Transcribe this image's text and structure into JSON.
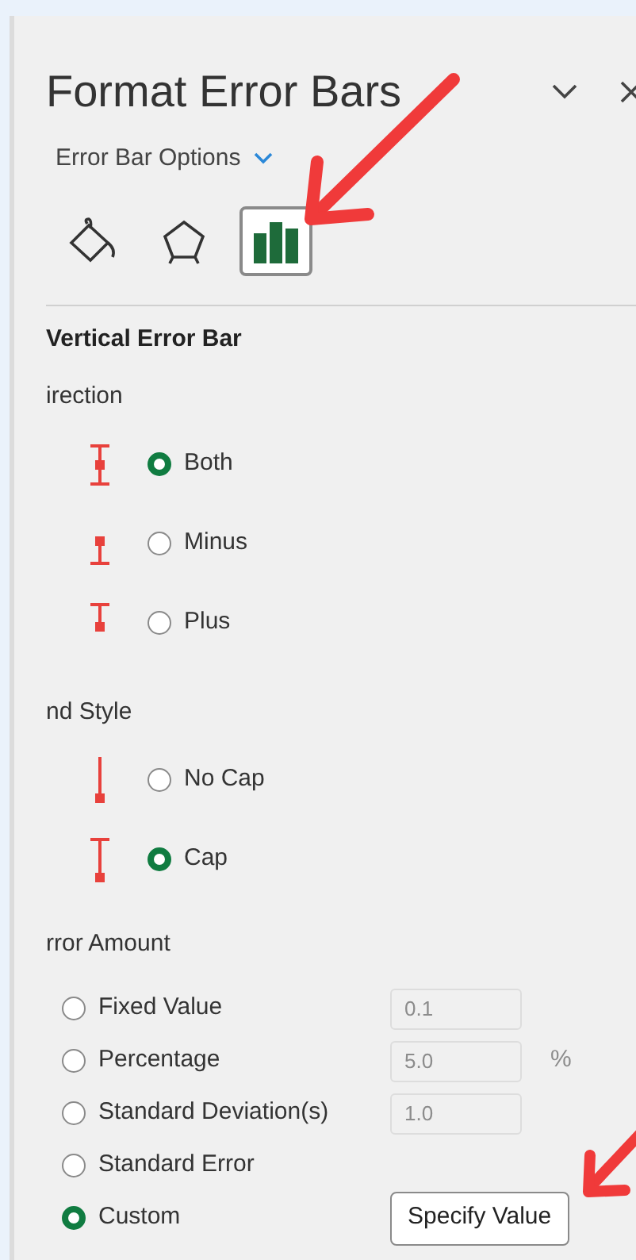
{
  "window": {
    "title": "Format Error Bars"
  },
  "dropdown": {
    "label": "Error Bar Options"
  },
  "tabs": [
    {
      "kind": "fill",
      "selected": false
    },
    {
      "kind": "effects",
      "selected": false
    },
    {
      "kind": "options",
      "selected": true
    }
  ],
  "section_title": "Vertical Error Bar",
  "direction": {
    "heading": "irection",
    "options": [
      {
        "label": "Both",
        "kind": "both",
        "selected": true
      },
      {
        "label": "Minus",
        "kind": "minus",
        "selected": false
      },
      {
        "label": "Plus",
        "kind": "plus",
        "selected": false
      }
    ]
  },
  "end_style": {
    "heading": "nd Style",
    "options": [
      {
        "label": "No Cap",
        "kind": "nocap",
        "selected": false
      },
      {
        "label": "Cap",
        "kind": "cap",
        "selected": true
      }
    ]
  },
  "error_amount": {
    "heading": "rror Amount",
    "options": [
      {
        "label": "Fixed Value",
        "selected": false,
        "value": "0.1",
        "disabled": true
      },
      {
        "label": "Percentage",
        "selected": false,
        "value": "5.0",
        "unit": "%",
        "disabled": true
      },
      {
        "label": "Standard Deviation(s)",
        "selected": false,
        "value": "1.0",
        "disabled": true
      },
      {
        "label": "Standard Error",
        "selected": false
      },
      {
        "label": "Custom",
        "selected": true,
        "button": "Specify Value"
      }
    ]
  }
}
